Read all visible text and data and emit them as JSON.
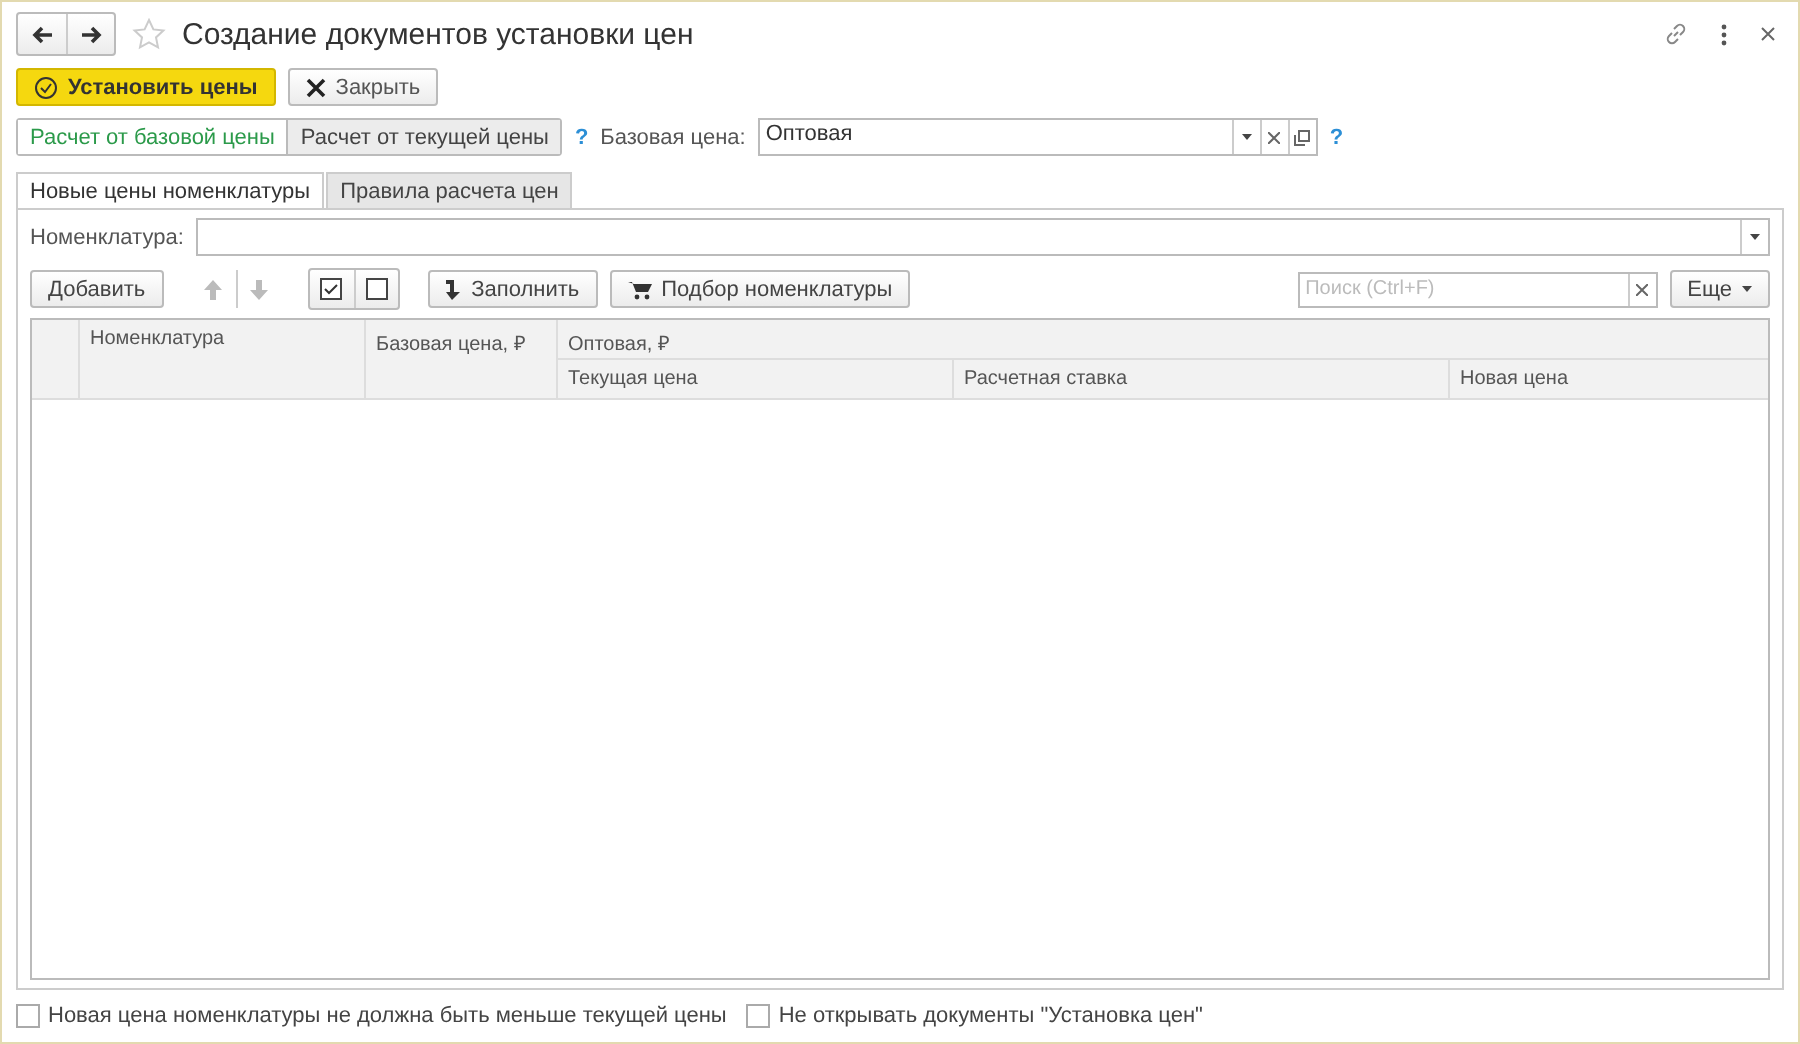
{
  "window": {
    "title": "Создание документов установки цен"
  },
  "commands": [
    {
      "label": "Установить цены",
      "kind": "primary"
    },
    {
      "label": "Закрыть",
      "kind": "close"
    }
  ],
  "calc_mode": [
    {
      "label": "Расчет от базовой цены",
      "selected": true
    },
    {
      "label": "Расчет от текущей цены",
      "selected": false
    }
  ],
  "help_mark": "?",
  "base_price": {
    "label": "Базовая цена:",
    "value": "Оптовая"
  },
  "base_help_mark": "?",
  "tabs": [
    {
      "label": "Новые цены номенклатуры",
      "selected": true
    },
    {
      "label": "Правила расчета цен",
      "selected": false
    }
  ],
  "filter": {
    "label": "Номенклатура:"
  },
  "toolbar": {
    "add": "Добавить",
    "fill": "Заполнить",
    "pick": "Подбор номенклатуры",
    "search_placeholder": "Поиск (Ctrl+F)",
    "more": "Еще"
  },
  "table": {
    "columns": [
      {
        "label": "Номенклатура"
      },
      {
        "label": "Базовая цена, ₽"
      }
    ],
    "group": {
      "label": "Оптовая, ₽",
      "columns": [
        {
          "label": "Текущая цена"
        },
        {
          "label": "Расчетная ставка"
        },
        {
          "label": "Новая цена"
        }
      ]
    }
  },
  "options": [
    {
      "label": "Новая цена номенклатуры не должна быть меньше текущей цены",
      "checked": false
    },
    {
      "label": "Не открывать документы \"Установка цен\"",
      "checked": false
    }
  ]
}
